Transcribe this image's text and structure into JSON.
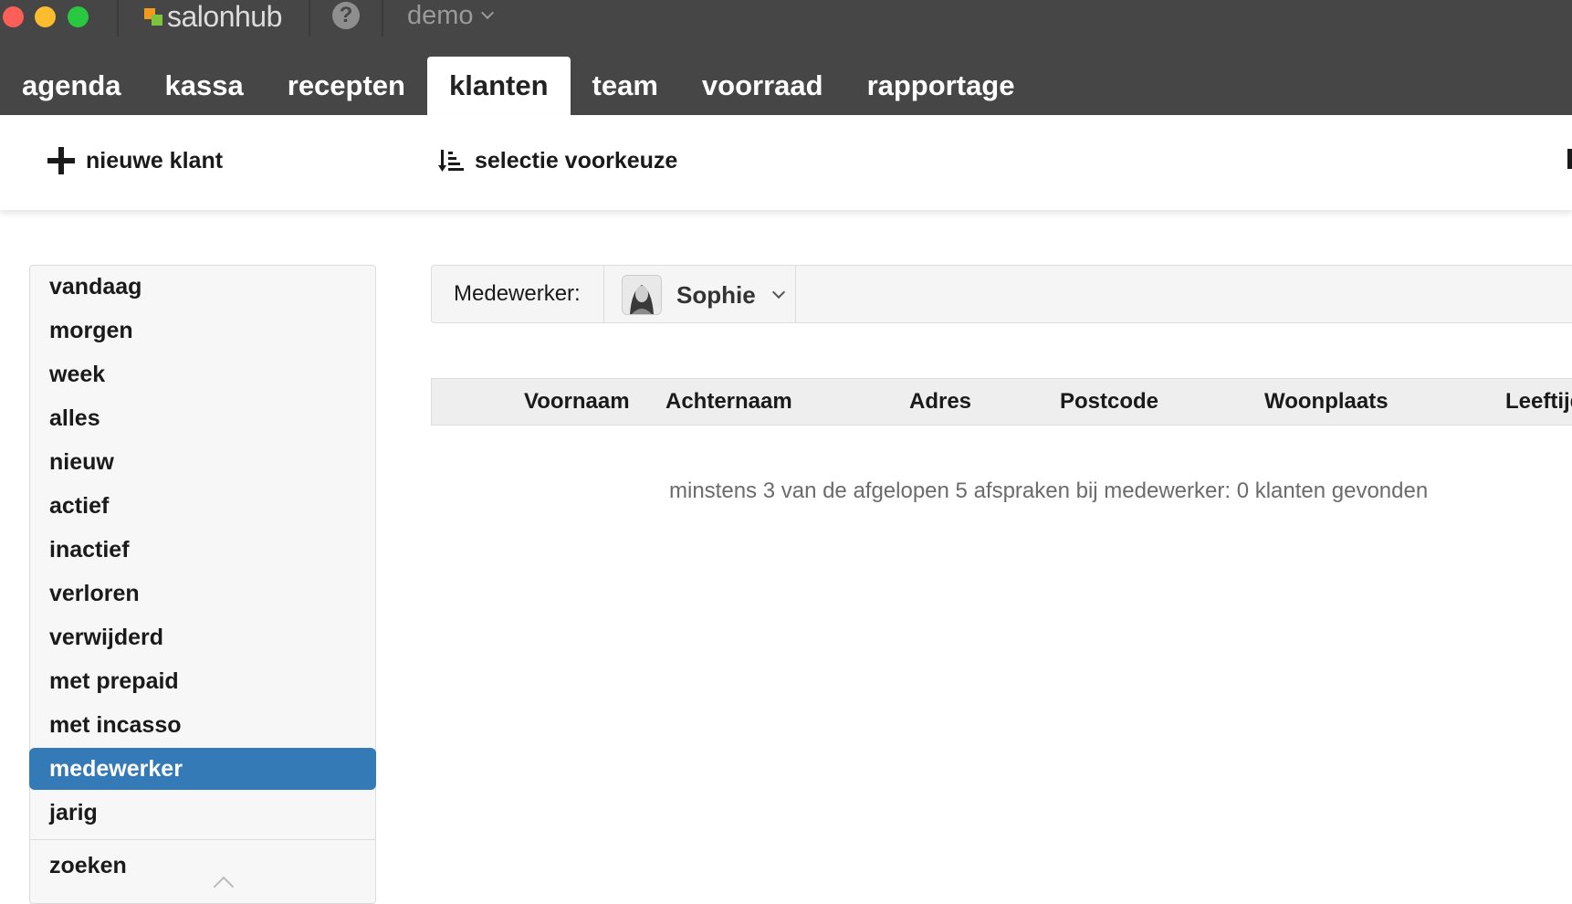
{
  "app": {
    "logo_text": "salonhub",
    "account_label": "demo",
    "colors": {
      "topbar": "#464646",
      "accent": "#337ab7",
      "logo_orange": "#f29a1c",
      "logo_green": "#7fc23e"
    }
  },
  "nav": {
    "tabs": [
      {
        "label": "agenda",
        "active": false
      },
      {
        "label": "kassa",
        "active": false
      },
      {
        "label": "recepten",
        "active": false
      },
      {
        "label": "klanten",
        "active": true
      },
      {
        "label": "team",
        "active": false
      },
      {
        "label": "voorraad",
        "active": false
      },
      {
        "label": "rapportage",
        "active": false
      }
    ]
  },
  "toolbar": {
    "new_client_label": "nieuwe klant",
    "new_client_icon": "plus-icon",
    "selection_label": "selectie voorkeuze",
    "selection_icon": "sort-icon"
  },
  "sidebar": {
    "items": [
      {
        "label": "vandaag",
        "active": false
      },
      {
        "label": "morgen",
        "active": false
      },
      {
        "label": "week",
        "active": false
      },
      {
        "label": "alles",
        "active": false
      },
      {
        "label": "nieuw",
        "active": false
      },
      {
        "label": "actief",
        "active": false
      },
      {
        "label": "inactief",
        "active": false
      },
      {
        "label": "verloren",
        "active": false
      },
      {
        "label": "verwijderd",
        "active": false
      },
      {
        "label": "met prepaid",
        "active": false
      },
      {
        "label": "met incasso",
        "active": false
      },
      {
        "label": "medewerker",
        "active": true
      },
      {
        "label": "jarig",
        "active": false
      }
    ],
    "search_label": "zoeken"
  },
  "filter": {
    "label": "Medewerker:",
    "selected_staff": "Sophie"
  },
  "table": {
    "columns": [
      "Voornaam",
      "Achternaam",
      "Adres",
      "Postcode",
      "Woonplaats",
      "Leeftijd"
    ],
    "rows": [],
    "empty_message": "minstens 3 van de afgelopen 5 afspraken bij medewerker: 0 klanten gevonden"
  }
}
